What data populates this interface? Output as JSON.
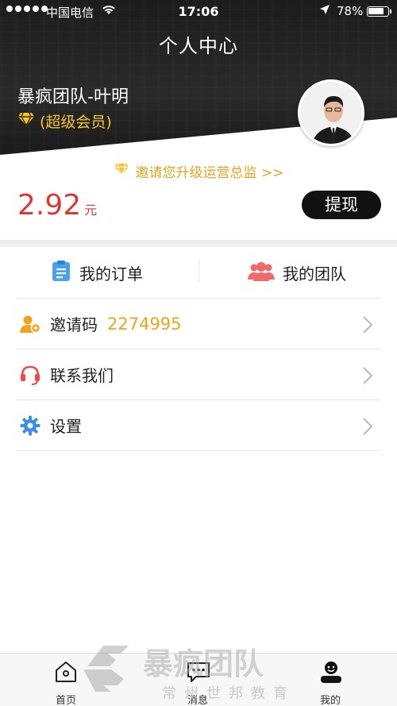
{
  "status_bar": {
    "carrier": "中国电信",
    "time": "17:06",
    "battery": "78%"
  },
  "header": {
    "title": "个人中心",
    "user_name": "暴疯团队-叶明",
    "membership": "(超级会员)"
  },
  "upgrade_link": "邀请您升级运营总监 >>",
  "balance": {
    "amount": "2.92",
    "unit": "元",
    "withdraw_label": "提现"
  },
  "tabs": {
    "orders": "我的订单",
    "team": "我的团队"
  },
  "menu": {
    "invite_label": "邀请码",
    "invite_code": "2274995",
    "contact_label": "联系我们",
    "settings_label": "设置"
  },
  "tabbar": {
    "home": "首页",
    "messages": "消息",
    "mine": "我的"
  },
  "watermark": {
    "title": "暴疯团队",
    "subtitle": "常州世邦教育"
  },
  "colors": {
    "accent_gold": "#f5c430",
    "balance_red": "#d83a3a",
    "invite_code_orange": "#f2a31e",
    "orders_icon_blue": "#4aa3e8",
    "team_icon_pink": "#f06a6a",
    "contact_icon_red": "#ee4b4b",
    "settings_icon_blue": "#3d8ee8"
  },
  "icons": [
    "wifi-icon",
    "location-arrow-icon",
    "battery-icon",
    "diamond-icon",
    "clipboard-icon",
    "team-icon",
    "user-add-icon",
    "headset-icon",
    "gear-icon",
    "chevron-right-icon",
    "home-icon",
    "message-icon",
    "user-icon"
  ]
}
